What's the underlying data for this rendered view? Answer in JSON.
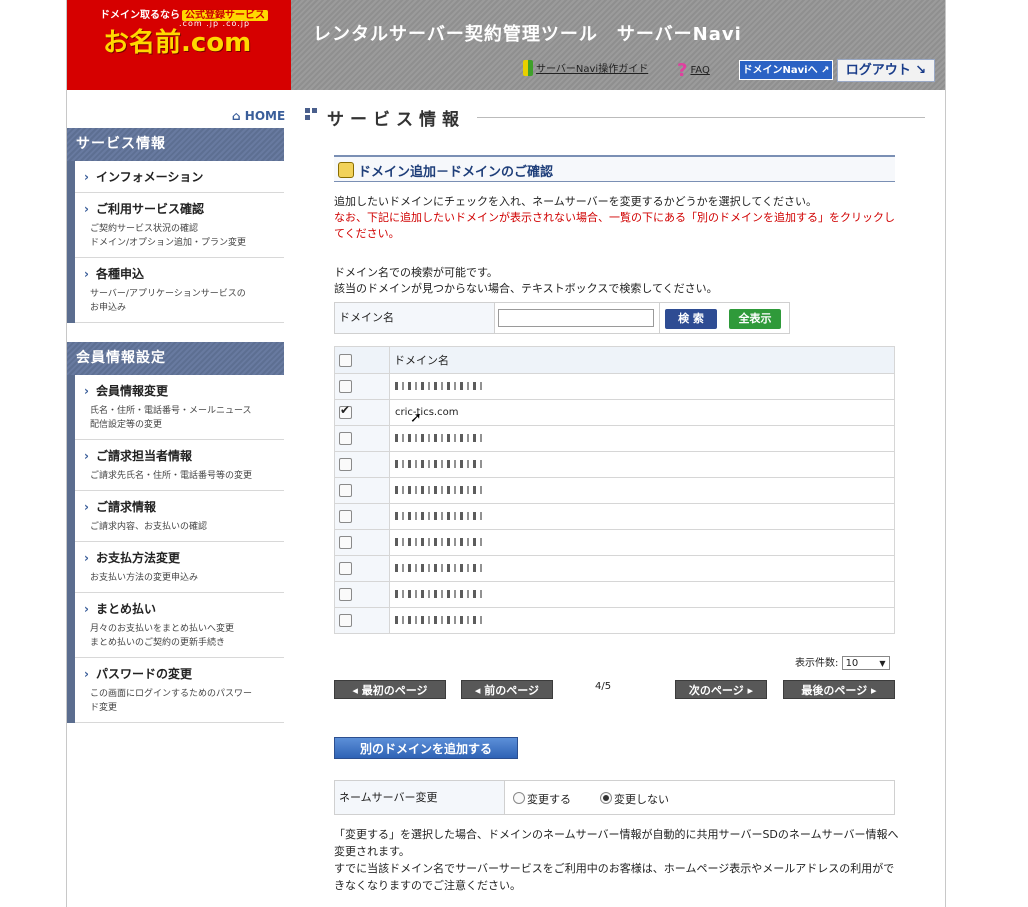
{
  "header": {
    "logo_tag": "ドメイン取るなら",
    "logo_badge": "公式登録サービス",
    "logo_tlds": ".com .jp .co.jp",
    "logo_main": "お名前.com",
    "app_title": "レンタルサーバー契約管理ツール　サーバーNavi",
    "guide_link": "サーバーNavi操作ガイド",
    "faq_link": "FAQ",
    "domain_navi_button": "ドメインNaviへ ↗",
    "logout_button": "ログアウト ↘"
  },
  "sidebar": {
    "home": "HOME",
    "sections": [
      {
        "title": "サービス情報",
        "items": [
          {
            "label": "インフォメーション",
            "desc": ""
          },
          {
            "label": "ご利用サービス確認",
            "desc": "ご契約サービス状況の確認\nドメイン/オプション追加・プラン変更"
          },
          {
            "label": "各種申込",
            "desc": "サーバー/アプリケーションサービスの\nお申込み"
          }
        ]
      },
      {
        "title": "会員情報設定",
        "items": [
          {
            "label": "会員情報変更",
            "desc": "氏名・住所・電話番号・メールニュース\n配信設定等の変更"
          },
          {
            "label": "ご請求担当者情報",
            "desc": "ご請求先氏名・住所・電話番号等の変更"
          },
          {
            "label": "ご請求情報",
            "desc": "ご請求内容、お支払いの確認"
          },
          {
            "label": "お支払方法変更",
            "desc": "お支払い方法の変更申込み"
          },
          {
            "label": "まとめ払い",
            "desc": "月々のお支払いをまとめ払いへ変更\nまとめ払いのご契約の更新手続き"
          },
          {
            "label": "パスワードの変更",
            "desc": "この画面にログインするためのパスワー\nド変更"
          }
        ]
      }
    ]
  },
  "main": {
    "page_title": "サービス情報",
    "section_title": "ドメイン追加－ドメインのご確認",
    "instruction": "追加したいドメインにチェックを入れ、ネームサーバーを変更するかどうかを選択してください。",
    "instruction_red": "なお、下記に追加したいドメインが表示されない場合、一覧の下にある「別のドメインを追加する」をクリックしてください。",
    "search_note_1": "ドメイン名での検索が可能です。",
    "search_note_2": "該当のドメインが見つからない場合、テキストボックスで検索してください。",
    "search": {
      "label": "ドメイン名",
      "value": "",
      "search_button": "検 索",
      "show_all_button": "全表示"
    },
    "table": {
      "header": "ドメイン名",
      "rows": [
        {
          "name": "",
          "checked": false,
          "redacted": true
        },
        {
          "name": "cric-tics.com",
          "checked": true,
          "redacted": false
        },
        {
          "name": "",
          "checked": false,
          "redacted": true
        },
        {
          "name": "",
          "checked": false,
          "redacted": true
        },
        {
          "name": "",
          "checked": false,
          "redacted": true
        },
        {
          "name": "",
          "checked": false,
          "redacted": true
        },
        {
          "name": "",
          "checked": false,
          "redacted": true
        },
        {
          "name": "",
          "checked": false,
          "redacted": true
        },
        {
          "name": "",
          "checked": false,
          "redacted": true
        },
        {
          "name": "",
          "checked": false,
          "redacted": true
        }
      ]
    },
    "per_page_label": "表示件数:",
    "per_page_value": "10",
    "pager": {
      "first": "◂ 最初のページ",
      "prev": "◂ 前のページ",
      "count": "4/5",
      "next": "次のページ ▸",
      "last": "最後のページ ▸"
    },
    "add_domain_button": "別のドメインを追加する",
    "nameserver": {
      "label": "ネームサーバー変更",
      "option_change": "変更する",
      "option_keep": "変更しない",
      "selected": "変更しない"
    },
    "note_1": "「変更する」を選択した場合、ドメインのネームサーバー情報が自動的に共用サーバーSDのネームサーバー情報へ変更されます。",
    "note_2": "すでに当該ドメイン名でサーバーサービスをご利用中のお客様は、ホームページ表示やメールアドレスの利用ができなくなりますのでご注意ください。"
  }
}
